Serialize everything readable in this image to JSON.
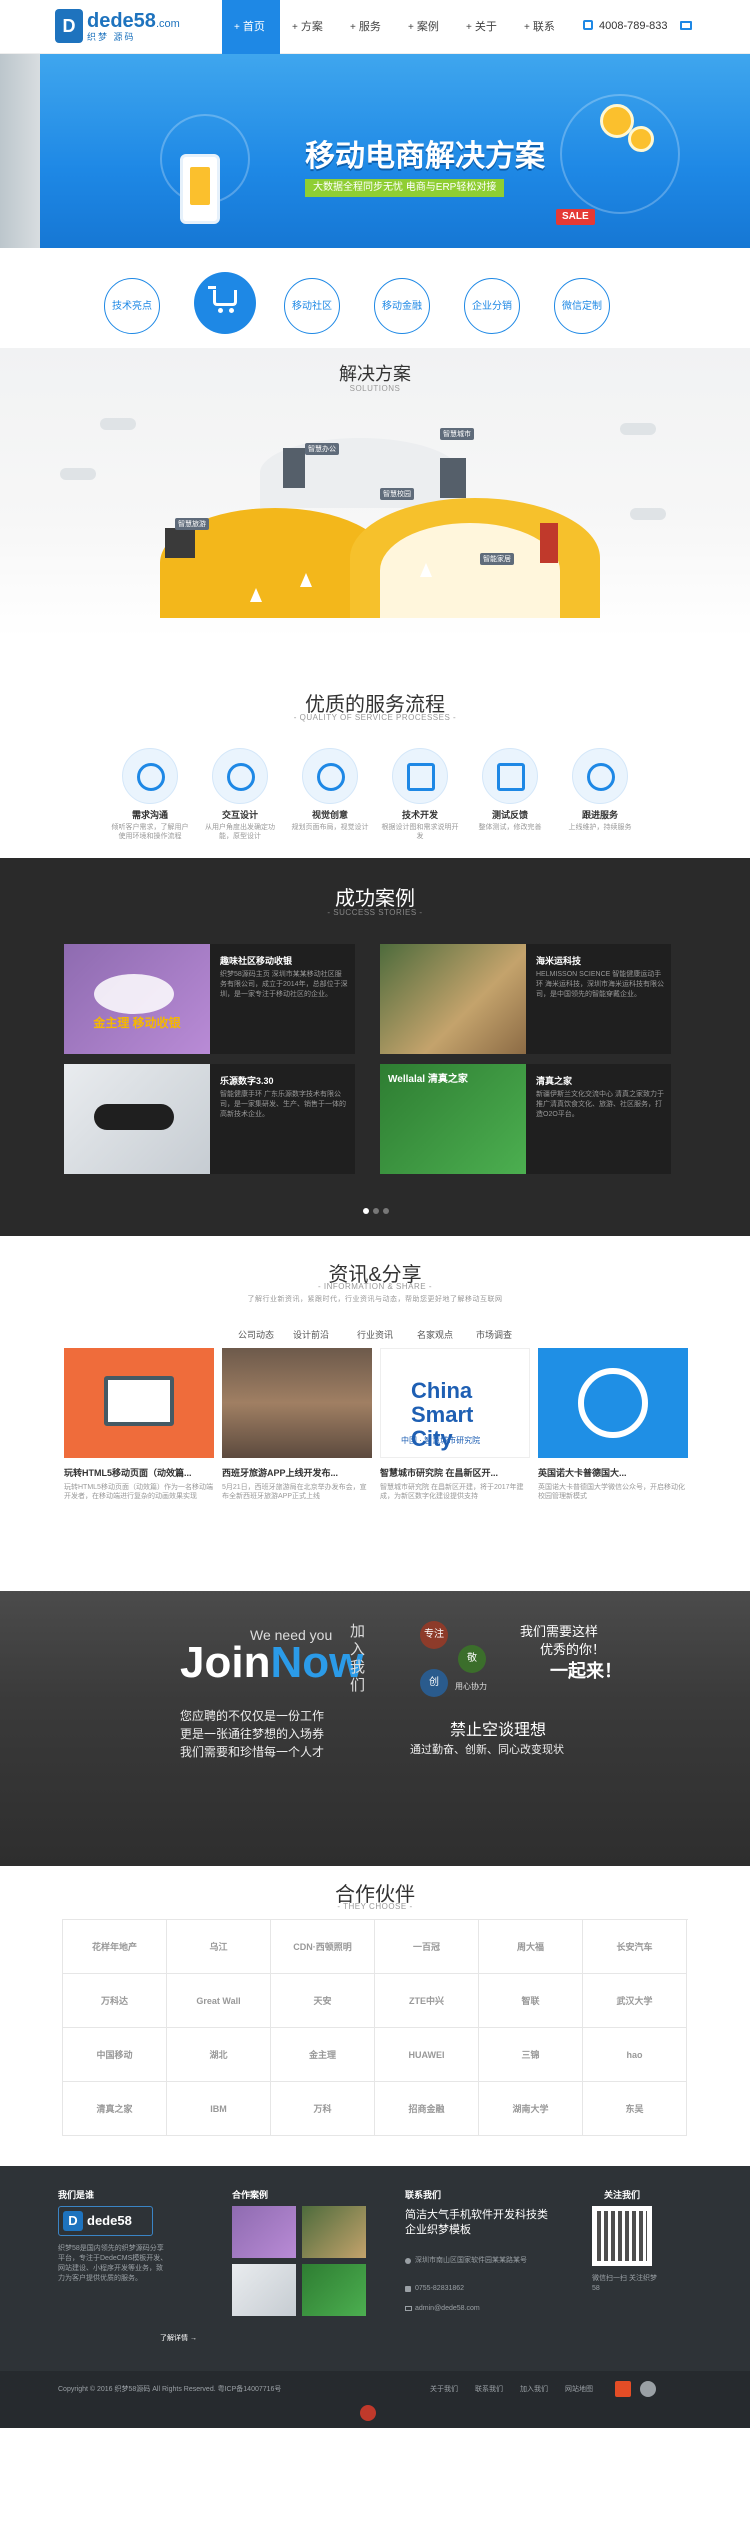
{
  "header": {
    "logo_badge": "D",
    "logo_text": "dede58",
    "logo_suffix": ".com",
    "logo_sub": "织梦 源码",
    "nav": [
      {
        "label": "首页",
        "active": true
      },
      {
        "label": "方案",
        "active": false
      },
      {
        "label": "服务",
        "active": false
      },
      {
        "label": "案例",
        "active": false
      },
      {
        "label": "关于",
        "active": false
      },
      {
        "label": "联系",
        "active": false
      }
    ],
    "phone": "4008-789-833"
  },
  "banner": {
    "title": "移动电商解决方案",
    "subtitle": "大数据全程同步无忧 电商与ERP轻松对接",
    "sale": "SALE"
  },
  "features": [
    "技术亮点",
    "",
    "移动社区",
    "移动金融",
    "企业分销",
    "微信定制"
  ],
  "solutions": {
    "title": "解决方案",
    "subtitle": "SOLUTIONS",
    "labels": [
      "智慧办公",
      "智慧城市",
      "智慧校园",
      "智慧旅游",
      "智能家居"
    ]
  },
  "process": {
    "title": "优质的服务流程",
    "subtitle": "- QUALITY OF SERVICE PROCESSES -",
    "steps": [
      {
        "name": "需求沟通",
        "desc": "倾听客户需求，了解用户使用环境和操作流程"
      },
      {
        "name": "交互设计",
        "desc": "从用户角度出发确定功能，原型设计"
      },
      {
        "name": "视觉创意",
        "desc": "规划页面布局，视觉设计"
      },
      {
        "name": "技术开发",
        "desc": "根据设计图和需求说明开发"
      },
      {
        "name": "测试反馈",
        "desc": "整体测试，修改完善"
      },
      {
        "name": "跟进服务",
        "desc": "上线维护，持续服务"
      }
    ]
  },
  "cases": {
    "title": "成功案例",
    "subtitle": "- SUCCESS STORIES -",
    "items": [
      {
        "title": "趣味社区移动收银",
        "desc": "织梦58源码主页 深圳市某某移动社区服务有限公司，成立于2014年，总部位于深圳，是一家专注于移动社区的企业。",
        "img_text": "金主理 移动收银"
      },
      {
        "title": "海米运科技",
        "desc": "HELMISSON SCIENCE 智能健康运动手环 海米运科技，深圳市海米运科技有限公司，是中国领先的智能穿戴企业。",
        "img_text": ""
      },
      {
        "title": "乐源数字3.30",
        "desc": "智能健康手环 广东乐源数字技术有限公司，是一家集研发、生产、销售于一体的高新技术企业。",
        "img_text": ""
      },
      {
        "title": "清真之家",
        "desc": "新疆伊斯兰文化交流中心 清真之家致力于推广清真饮食文化、旅游、社区服务，打造O2O平台。",
        "img_text": "Wellalal 清真之家"
      }
    ]
  },
  "news": {
    "title": "资讯&分享",
    "subtitle": "- INFORMATION & SHARE -",
    "intro": "了解行业新资讯，紧跟时代，行业资讯与动态，帮助您更好地了解移动互联网",
    "tabs": [
      "公司动态",
      "设计前沿",
      "行业资讯",
      "名家观点",
      "市场调查"
    ],
    "items": [
      {
        "title": "玩转HTML5移动页面（动效篇...",
        "desc": "玩转HTML5移动页面（动效篇）作为一名移动端开发者，在移动端进行复杂的动画效果实现"
      },
      {
        "title": "西班牙旅游APP上线开发布...",
        "desc": "5月21日，西班牙旅游局在北京举办发布会，宣布全新西班牙旅游APP正式上线"
      },
      {
        "title": "智慧城市研究院 在昌新区开...",
        "desc": "智慧城市研究院 在昌新区开建，将于2017年建成，为新区数字化建设提供支持"
      },
      {
        "title": "英国诺大卡普德国大...",
        "desc": "英国诺大卡普德国大学微信公众号，开启移动化校园管理新模式"
      }
    ],
    "img_labels": [
      "China Smart City",
      "中国 · 智慧城市研究院"
    ]
  },
  "join": {
    "title_en": "Join",
    "title_en2": "Now",
    "we_need": "We need you",
    "vertical": "加入我们",
    "poem": [
      "您应聘的不仅仅是一份工作",
      "更是一张通往梦想的入场券",
      "我们需要和珍惜每一个人才"
    ],
    "right": [
      "我们需要这样",
      "优秀的你！",
      "一起来！"
    ],
    "chars": [
      "专注",
      "敬",
      "创",
      "用心协力"
    ],
    "slogan": "禁止空谈理想",
    "slogan_sub": "通过勤奋、创新、同心改变现状"
  },
  "partners": {
    "title": "合作伙伴",
    "subtitle": "- THEY CHOOSE -",
    "logos": [
      "花样年地产",
      "乌江",
      "CDN·西顿照明",
      "一百冠",
      "周大福",
      "长安汽车",
      "万科达",
      "Great Wall",
      "天安",
      "ZTE中兴",
      "智联",
      "武汉大学",
      "中国移动",
      "湖北",
      "金主理",
      "HUAWEI",
      "三锦",
      "hao",
      "清真之家",
      "IBM",
      "万科",
      "招商金融",
      "湖南大学",
      "东吴"
    ]
  },
  "footer": {
    "about_title": "我们是谁",
    "about_desc": "织梦58是国内领先的织梦源码分享平台，专注于DedeCMS模板开发、网站建设、小程序开发等业务，致力为客户提供优质的服务。",
    "more": "了解详情 →",
    "cases_title": "合作案例",
    "contact_title": "联系我们",
    "contact_slogan": "简洁大气手机软件开发科技类企业织梦模板",
    "address": "深圳市南山区国家软件园某某路某号",
    "phone": "0755-82831862",
    "email": "admin@dede58.com",
    "follow_title": "关注我们",
    "follow_desc": "微信扫一扫 关注织梦58",
    "copyright": "Copyright © 2016 织梦58源码 All Rights Reserved. 粤ICP备14007716号",
    "links": [
      "关于我们",
      "联系我们",
      "加入我们",
      "网站地图"
    ]
  }
}
